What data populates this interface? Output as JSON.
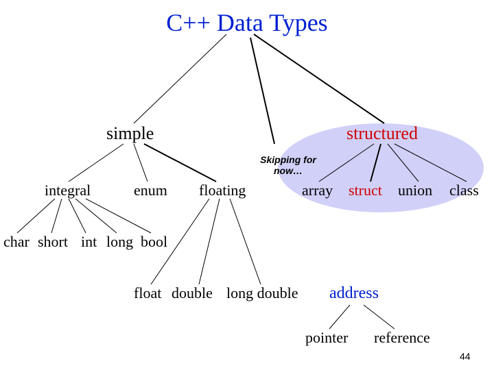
{
  "title": "C++  Data Types",
  "level1": {
    "simple": "simple",
    "structured": "structured"
  },
  "simple_children": {
    "integral": "integral",
    "enum": "enum",
    "floating": "floating"
  },
  "structured_children": {
    "array": "array",
    "struct": "struct",
    "union": "union",
    "class": "class"
  },
  "integral_children": {
    "char": "char",
    "short": "short",
    "int": "int",
    "long": "long",
    "bool": "bool"
  },
  "floating_children": {
    "float": "float",
    "double": "double",
    "longdouble": "long double"
  },
  "address": {
    "label": "address",
    "pointer": "pointer",
    "reference": "reference"
  },
  "annotation": "Skipping for\nnow…",
  "page_number": "44"
}
